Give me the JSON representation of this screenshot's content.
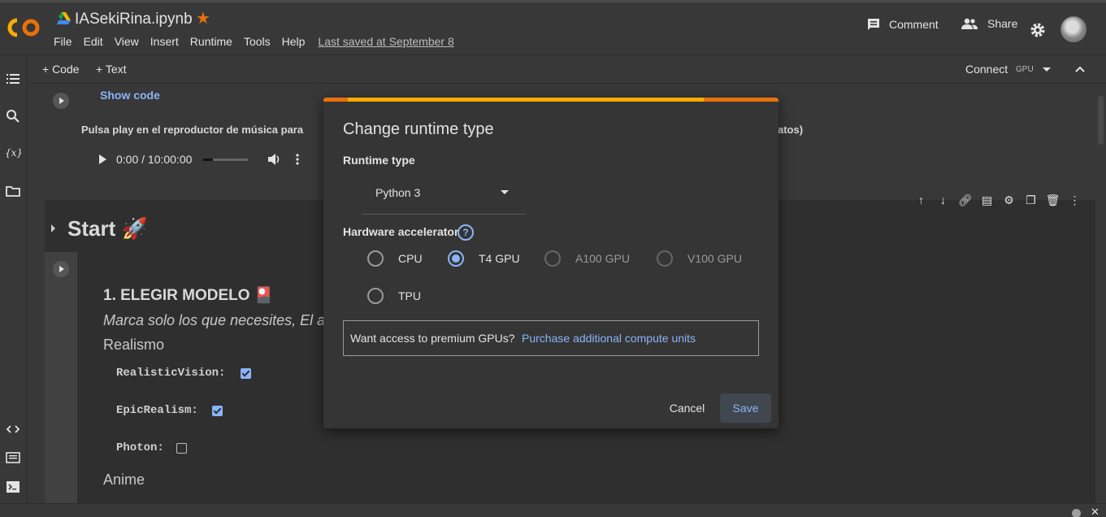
{
  "app": {
    "notebook_title": "IASekiRina.ipynb",
    "menu": [
      "File",
      "Edit",
      "View",
      "Insert",
      "Runtime",
      "Tools",
      "Help"
    ],
    "last_saved": "Last saved at September 8",
    "comment_label": "Comment",
    "share_label": "Share"
  },
  "toolbar": {
    "code_label": "+ Code",
    "text_label": "+ Text",
    "connect_label": "Connect",
    "gpu_label": "GPU"
  },
  "notebook": {
    "show_code": "Show code",
    "pulsa_text": "Pulsa play en el reproductor de música para",
    "pulsa_tail": "atos)",
    "audio_time": "0:00 / 10:00:00",
    "section_title": "Start 🚀",
    "heading": "1. ELEGIR MODELO 🎴",
    "italic_text": "Marca solo los que necesites, El alma",
    "realismo": "Realismo",
    "params": [
      {
        "name": "RealisticVision:",
        "checked": true
      },
      {
        "name": "EpicRealism:",
        "checked": true
      },
      {
        "name": "Photon:",
        "checked": false
      }
    ],
    "anime": "Anime"
  },
  "dialog": {
    "title": "Change runtime type",
    "runtime_label": "Runtime type",
    "runtime_value": "Python 3",
    "hardware_label": "Hardware accelerator",
    "help_icon": "?",
    "accelerators": [
      {
        "label": "CPU",
        "selected": false,
        "disabled": false
      },
      {
        "label": "T4 GPU",
        "selected": true,
        "disabled": false
      },
      {
        "label": "A100 GPU",
        "selected": false,
        "disabled": true
      },
      {
        "label": "V100 GPU",
        "selected": false,
        "disabled": true
      },
      {
        "label": "TPU",
        "selected": false,
        "disabled": false
      }
    ],
    "premium_text": "Want access to premium GPUs?",
    "premium_link": "Purchase additional compute units",
    "cancel_label": "Cancel",
    "save_label": "Save"
  },
  "colors": {
    "accent_blue": "#8ab4f8",
    "brand_orange": "#f9ab00",
    "star_orange": "#e8710a"
  }
}
